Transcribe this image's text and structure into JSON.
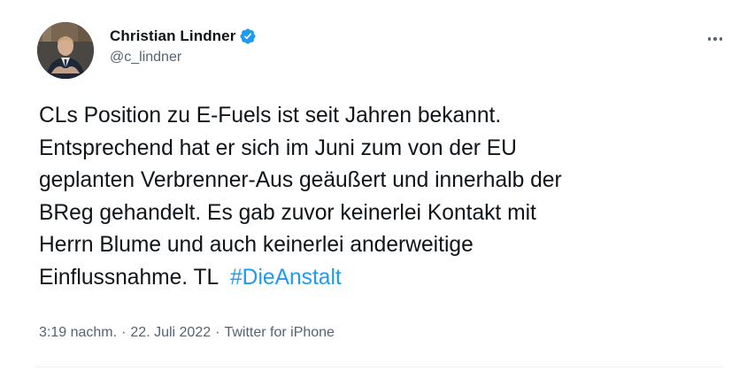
{
  "author": {
    "display_name": "Christian Lindner",
    "handle": "@c_lindner",
    "verified": true
  },
  "tweet": {
    "lines": [
      "CLs Position zu E-Fuels ist seit Jahren bekannt.",
      "Entsprechend hat er sich im Juni zum von der EU",
      "geplanten Verbrenner-Aus geäußert und innerhalb der",
      "BReg gehandelt. Es gab zuvor keinerlei Kontakt mit",
      "Herrn Blume und auch keinerlei anderweitige"
    ],
    "last_line_text": "Einflussnahme. TL ",
    "hashtag": "#DieAnstalt"
  },
  "meta": {
    "time": "3:19 nachm.",
    "date": "22. Juli 2022",
    "source": "Twitter for iPhone",
    "separator": "·"
  },
  "colors": {
    "text": "#0f1419",
    "secondary": "#536471",
    "link": "#1d9bf0",
    "verified": "#1d9bf0"
  },
  "icons": {
    "verified": "verified-badge-icon",
    "more": "more-dots-icon"
  }
}
